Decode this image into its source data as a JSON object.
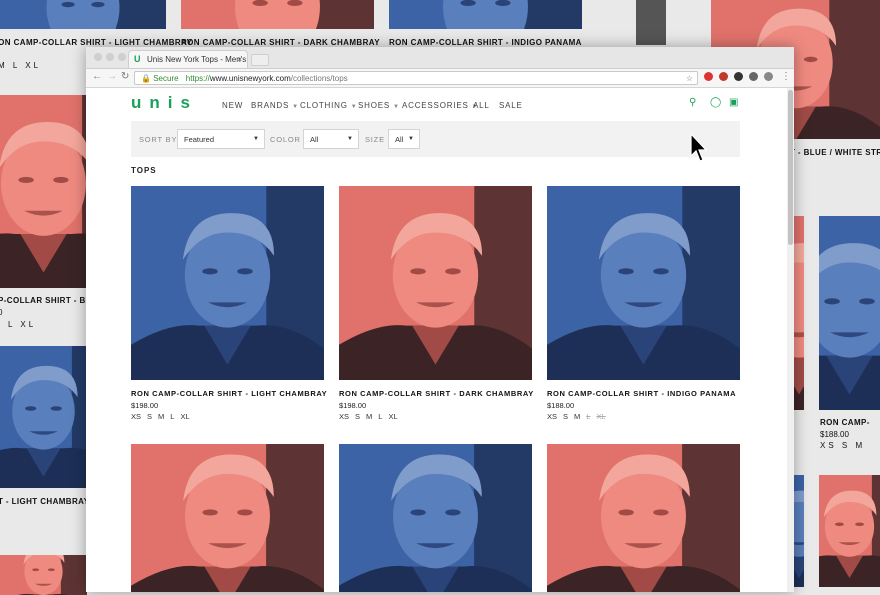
{
  "background": {
    "top_row_labels": [
      "RON CAMP-COLLAR SHIRT - LIGHT CHAMBRAY",
      "RON CAMP-COLLAR SHIRT - DARK CHAMBRAY",
      "RON CAMP-COLLAR SHIRT - INDIGO PANAMA"
    ],
    "top_sizes": "M L XL",
    "left_labels": [
      "P-COLLAR SHIRT - BLU",
      "T - LIGHT CHAMBRAY"
    ],
    "left_price": "0",
    "left_sizes": "L XL",
    "right_label_top": "T - BLUE / WHITE STR",
    "right_label_bottom": "RON CAMP-",
    "right_price": "$188.00",
    "right_sizes": "XS S M"
  },
  "browser": {
    "tab_title": "Unis New York Tops - Men's S",
    "tab_favicon": "U",
    "tab_close": "×",
    "secure_label": "Secure",
    "url_prefix": "https://",
    "url_domain": "www.unisnewyork.com",
    "url_path": "/collections/tops",
    "back": "←",
    "forward": "→",
    "reload": "↻",
    "star": "☆",
    "menu": "⋮"
  },
  "site": {
    "logo": "unis",
    "nav": [
      {
        "label": "NEW",
        "has_menu": false
      },
      {
        "label": "BRANDS",
        "has_menu": true
      },
      {
        "label": "CLOTHING",
        "has_menu": true
      },
      {
        "label": "SHOES",
        "has_menu": true
      },
      {
        "label": "ACCESSORIES",
        "has_menu": true
      },
      {
        "label": "ALL",
        "has_menu": false
      },
      {
        "label": "SALE",
        "has_menu": false
      }
    ],
    "header_icons": [
      "search-icon",
      "account-icon",
      "bag-icon"
    ],
    "brand_color": "#1aa05a"
  },
  "filters": {
    "sort_label": "SORT BY",
    "sort_value": "Featured",
    "color_label": "COLOR",
    "color_value": "All",
    "size_label": "SIZE",
    "size_value": "All"
  },
  "section_title": "TOPS",
  "products": [
    {
      "name": "RON CAMP-COLLAR SHIRT - LIGHT CHAMBRAY",
      "price": "$198.00",
      "tint": "blue",
      "sizes": [
        {
          "s": "XS",
          "available": true
        },
        {
          "s": "S",
          "available": true
        },
        {
          "s": "M",
          "available": true
        },
        {
          "s": "L",
          "available": true
        },
        {
          "s": "XL",
          "available": true
        }
      ]
    },
    {
      "name": "RON CAMP-COLLAR SHIRT - DARK CHAMBRAY",
      "price": "$198.00",
      "tint": "red",
      "sizes": [
        {
          "s": "XS",
          "available": true
        },
        {
          "s": "S",
          "available": true
        },
        {
          "s": "M",
          "available": true
        },
        {
          "s": "L",
          "available": true
        },
        {
          "s": "XL",
          "available": true
        }
      ]
    },
    {
      "name": "RON CAMP-COLLAR SHIRT - INDIGO PANAMA",
      "price": "$188.00",
      "tint": "blue",
      "sizes": [
        {
          "s": "XS",
          "available": true
        },
        {
          "s": "S",
          "available": true
        },
        {
          "s": "M",
          "available": true
        },
        {
          "s": "L",
          "available": false
        },
        {
          "s": "XL",
          "available": false
        }
      ]
    }
  ],
  "second_row_tints": [
    "red",
    "blue",
    "red"
  ]
}
